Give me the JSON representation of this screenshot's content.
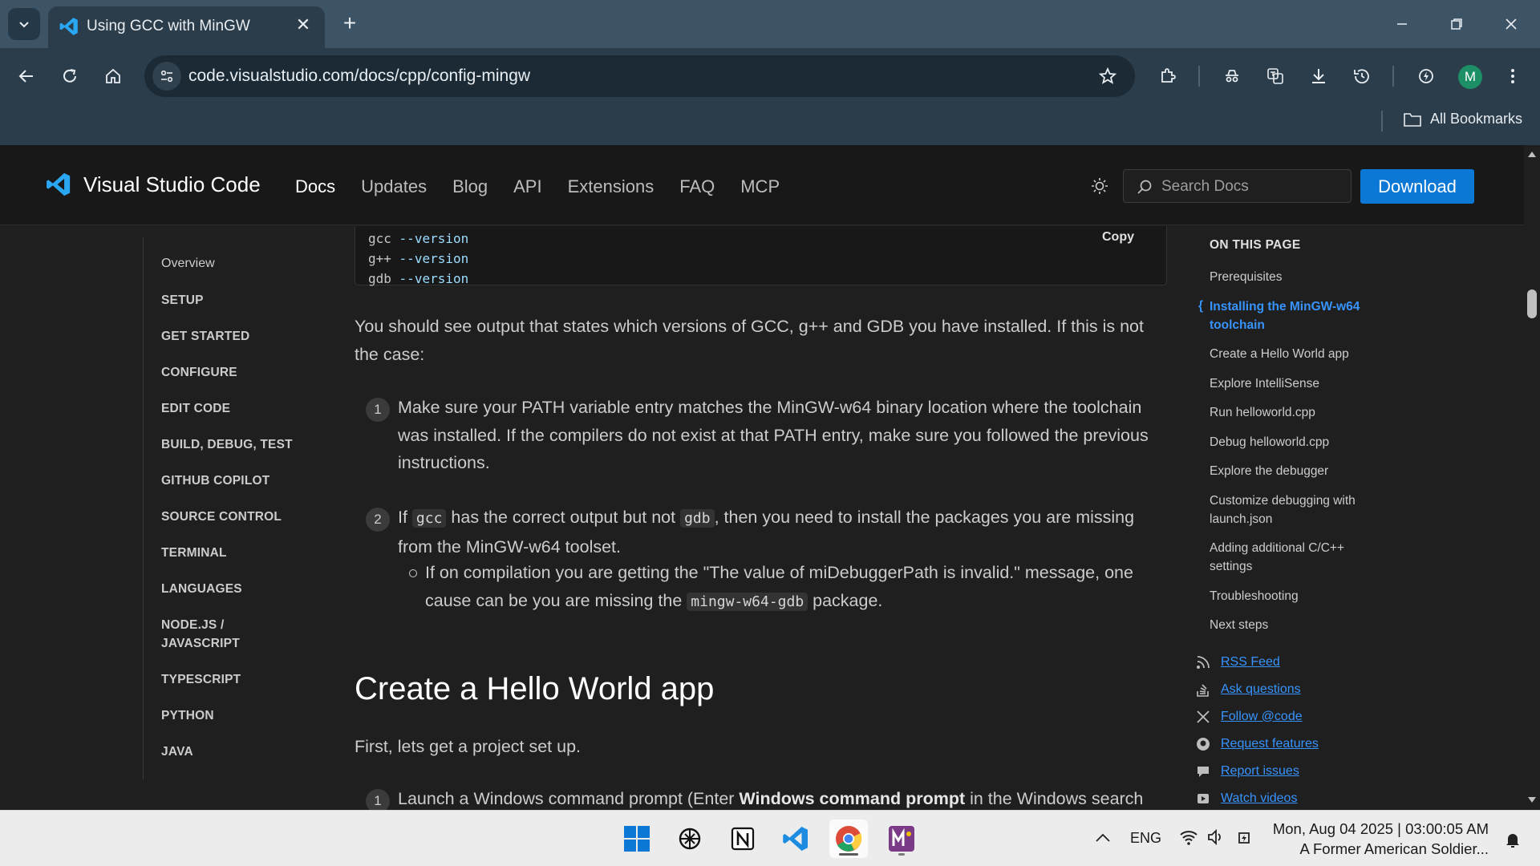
{
  "browser": {
    "tab_title": "Using GCC with MinGW",
    "url": "code.visualstudio.com/docs/cpp/config-mingw",
    "profile_initial": "M",
    "bookmarks_label": "All Bookmarks"
  },
  "site": {
    "brand": "Visual Studio Code",
    "nav": [
      "Docs",
      "Updates",
      "Blog",
      "API",
      "Extensions",
      "FAQ",
      "MCP"
    ],
    "search_placeholder": "Search Docs",
    "download_label": "Download"
  },
  "left_nav": {
    "overview": "Overview",
    "items": [
      "SETUP",
      "GET STARTED",
      "CONFIGURE",
      "EDIT CODE",
      "BUILD, DEBUG, TEST",
      "GITHUB COPILOT",
      "SOURCE CONTROL",
      "TERMINAL",
      "LANGUAGES",
      "NODE.JS / JAVASCRIPT",
      "TYPESCRIPT",
      "PYTHON",
      "JAVA"
    ]
  },
  "code_block": {
    "lines": [
      {
        "cmd": "gcc",
        "arg": "--version"
      },
      {
        "cmd": "g++",
        "arg": "--version"
      },
      {
        "cmd": "gdb",
        "arg": "--version"
      }
    ],
    "copy_label": "Copy"
  },
  "article": {
    "para1": "You should see output that states which versions of GCC, g++ and GDB you have installed. If this is not the case:",
    "step1_num": "1",
    "step1": "Make sure your PATH variable entry matches the MinGW-w64 binary location where the toolchain was installed. If the compilers do not exist at that PATH entry, make sure you followed the previous instructions.",
    "step2_num": "2",
    "step2_a": "If ",
    "step2_code1": "gcc",
    "step2_b": " has the correct output but not ",
    "step2_code2": "gdb",
    "step2_c": ", then you need to install the packages you are missing from the MinGW-w64 toolset.",
    "sub_a": "If on compilation you are getting the \"The value of miDebuggerPath is invalid.\" message, one cause can be you are missing the ",
    "sub_code": "mingw-w64-gdb",
    "sub_b": " package.",
    "h2": "Create a Hello World app",
    "para2": "First, lets get a project set up.",
    "step3_num": "1",
    "step3_a": "Launch a Windows command prompt (Enter ",
    "step3_bold": "Windows command prompt",
    "step3_b": " in the Windows search"
  },
  "toc": {
    "title": "ON THIS PAGE",
    "items": [
      "Prerequisites",
      "Installing the MinGW-w64 toolchain",
      "Create a Hello World app",
      "Explore IntelliSense",
      "Run helloworld.cpp",
      "Debug helloworld.cpp",
      "Explore the debugger",
      "Customize debugging with launch.json",
      "Adding additional C/C++ settings",
      "Troubleshooting",
      "Next steps"
    ],
    "active_index": 1,
    "links": [
      "RSS Feed",
      "Ask questions",
      "Follow @code",
      "Request features",
      "Report issues",
      "Watch videos"
    ]
  },
  "taskbar": {
    "lang": "ENG",
    "date": "Mon, Aug 04 2025 | 03:00:05 AM",
    "media": "A Former American Soldier..."
  },
  "colors": {
    "accent": "#0a78d4",
    "link": "#3794ff",
    "chrome_tabbar": "#3d5366",
    "chrome_toolbar": "#2b3c4a"
  }
}
